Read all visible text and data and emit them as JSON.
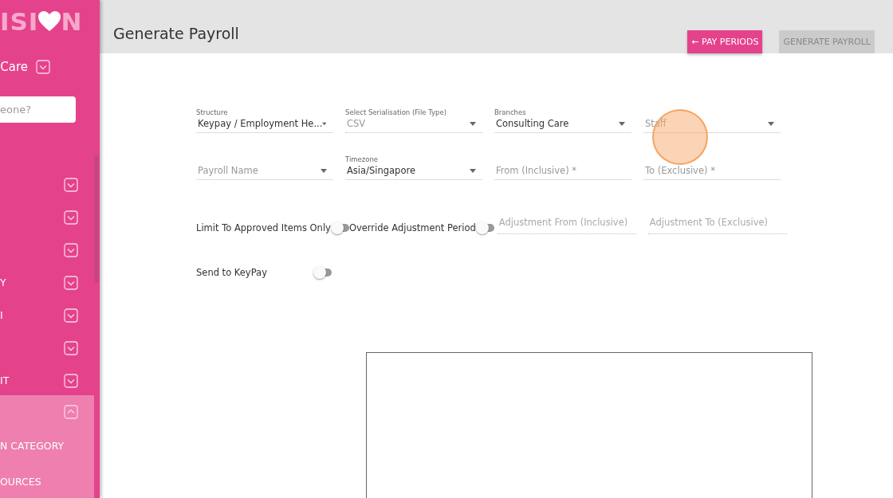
{
  "sidebar": {
    "logo": {
      "before": "ISI",
      "after": "N"
    },
    "branch": "Care",
    "search": {
      "placeholder": "eone?"
    },
    "items": [
      {
        "expanded": false
      },
      {
        "expanded": false
      },
      {
        "expanded": false
      },
      {
        "label": "Y",
        "expanded": false
      },
      {
        "label": "I",
        "expanded": false
      },
      {
        "expanded": false
      },
      {
        "label": "IT",
        "expanded": false
      },
      {
        "expanded": true,
        "children": [
          {
            "label": "N CATEGORY"
          },
          {
            "label": "OURCES"
          }
        ]
      }
    ]
  },
  "header": {
    "title": "Generate Payroll",
    "buttons": [
      {
        "label": "← PAY PERIODS",
        "disabled": false
      },
      {
        "label": "GENERATE PAYROLL",
        "disabled": true
      }
    ]
  },
  "fields": [
    {
      "label": "Structure",
      "value": "Keypay / Employment He...",
      "kind": "select",
      "disabled": false
    },
    {
      "label": "Select Serialisation (File Type)",
      "value": "CSV",
      "kind": "select",
      "disabled": true
    },
    {
      "label": "Branches",
      "value": "Consulting Care",
      "kind": "select",
      "disabled": false
    },
    {
      "placeholder": "Staff",
      "kind": "select",
      "disabled": false
    },
    {
      "placeholder": "Payroll Name",
      "kind": "select",
      "disabled": false
    },
    {
      "label": "Timezone",
      "value": "Asia/Singapore",
      "kind": "select",
      "disabled": false
    },
    {
      "placeholder": "From (Inclusive) *",
      "kind": "text",
      "disabled": false
    },
    {
      "placeholder": "To (Exclusive) *",
      "kind": "text",
      "disabled": false
    }
  ],
  "toggles_row": [
    {
      "kind": "toggle",
      "label": "Limit To Approved Items Only",
      "on": false
    },
    {
      "kind": "toggle",
      "label": "Override Adjustment Period",
      "on": false
    },
    {
      "kind": "text",
      "placeholder": "Adjustment From (Inclusive)",
      "disabled": true
    },
    {
      "kind": "text",
      "placeholder": "Adjustment To (Exclusive)",
      "disabled": true
    }
  ],
  "send_toggle": {
    "label": "Send to KeyPay",
    "on": false
  }
}
